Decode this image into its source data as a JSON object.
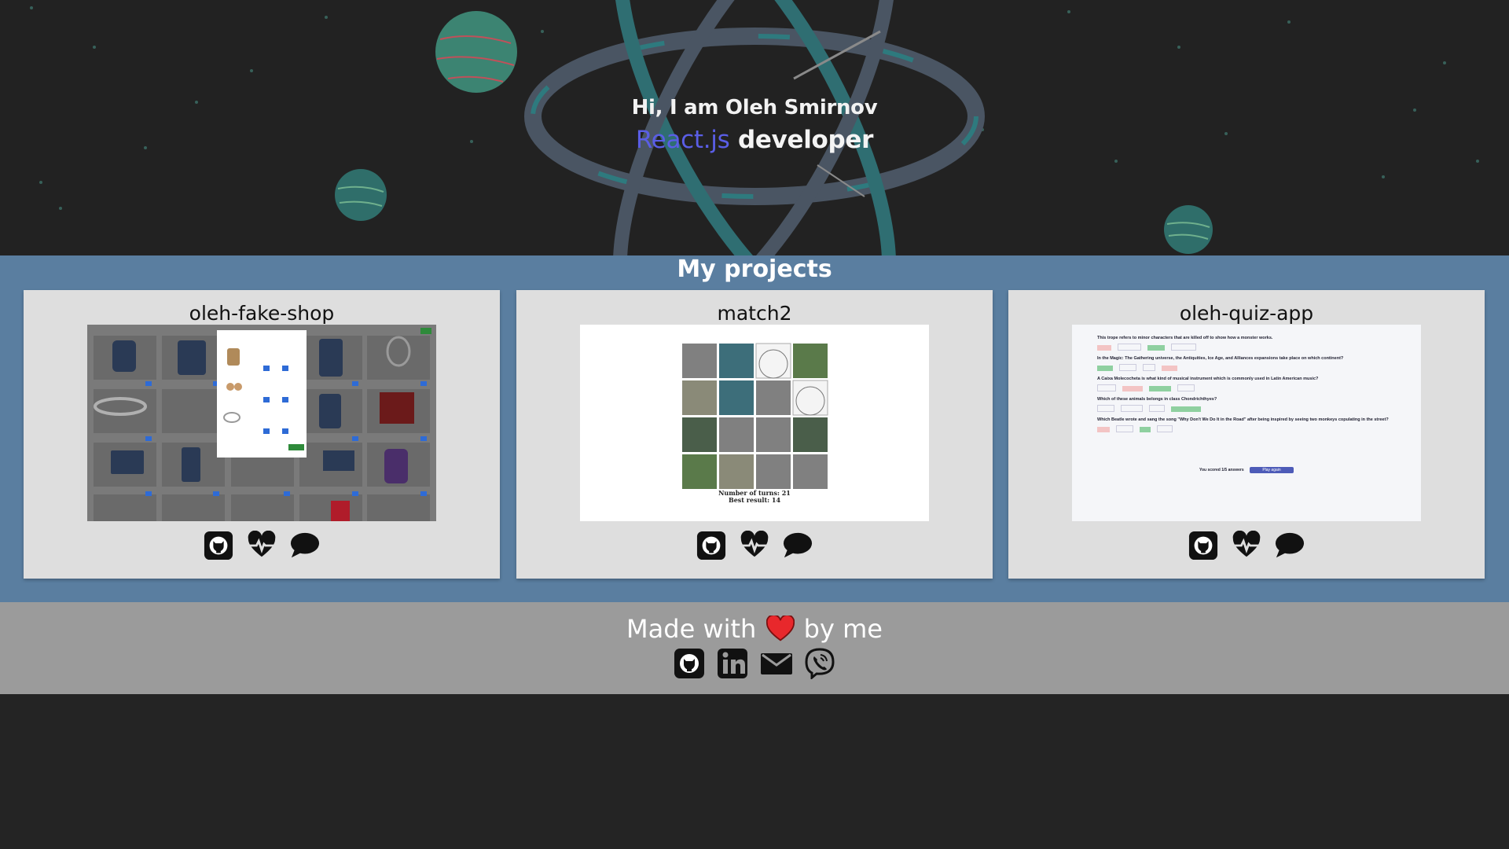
{
  "hero": {
    "greeting": "Hi, I am Oleh Smirnov",
    "role_accent": "React.js",
    "role_rest": "developer"
  },
  "projects": {
    "title": "My projects",
    "items": [
      {
        "name": "oleh-fake-shop",
        "icons": [
          "github-icon",
          "heartbeat-icon",
          "speech-bubble-icon"
        ]
      },
      {
        "name": "match2",
        "icons": [
          "github-icon",
          "heartbeat-icon",
          "speech-bubble-icon"
        ],
        "preview": {
          "turns": "Number of turns: 21",
          "best": "Best result: 14"
        }
      },
      {
        "name": "oleh-quiz-app",
        "icons": [
          "github-icon",
          "heartbeat-icon",
          "speech-bubble-icon"
        ],
        "preview": {
          "q1": "This trope refers to minor characters that are killed off to show how a monster works.",
          "q2": "In the Magic: The Gathering universe, the Antiquities, Ice Age, and Alliances expansions take place on which continent?",
          "q3": "A Caixa Molecocheta is what kind of musical instrument which is commonly used in Latin American music?",
          "q4": "Which of these animals belongs in class Chondrichthyes?",
          "q5": "Which Beatle wrote and sang the song \"Why Don't We Do It in the Road\" after being inspired by seeing two monkeys copulating in the street?",
          "score": "You scored 1/5 answers",
          "play_again": "Play again"
        }
      }
    ]
  },
  "footer": {
    "made_with": "Made with",
    "by_me": "by me",
    "icons": [
      "github-icon",
      "linkedin-icon",
      "mail-icon",
      "viber-icon"
    ]
  },
  "colors": {
    "hero_bg": "#222222",
    "accent": "#5a5ee6",
    "projects_bg": "#5a7ea0",
    "card_bg": "#dedede",
    "footer_bg": "#9b9b9b",
    "heart": "#e8282c"
  }
}
